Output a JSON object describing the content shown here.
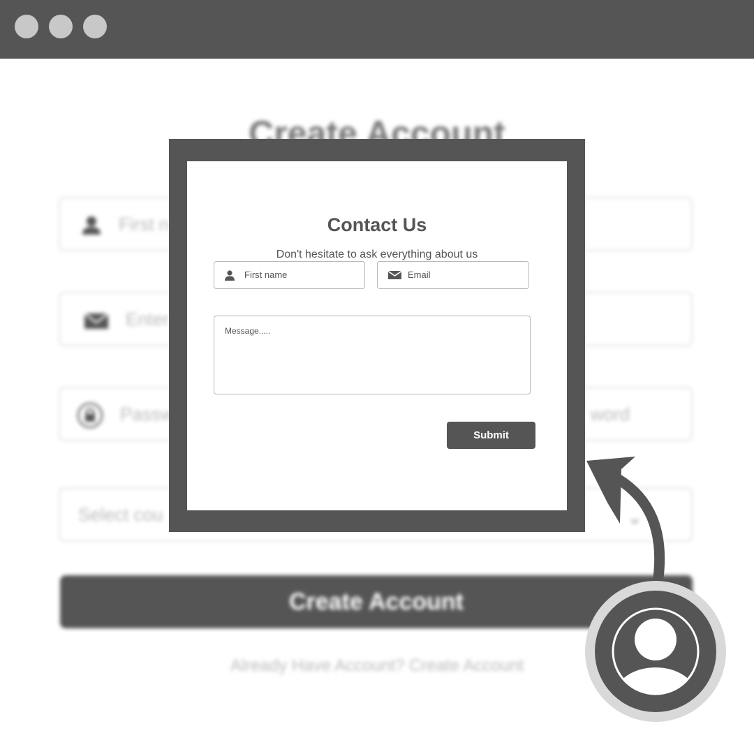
{
  "window": {
    "controls": [
      "close",
      "minimize",
      "maximize"
    ]
  },
  "background_form": {
    "title": "Create Account",
    "fields": [
      {
        "placeholder": "First n",
        "icon": "user-icon"
      },
      {
        "placeholder": "Enter",
        "icon": "mail-icon"
      },
      {
        "placeholder": "Passw",
        "right_text": "word",
        "icon": "lock-icon"
      },
      {
        "placeholder": "Select cou",
        "icon": "chevron-down-icon"
      }
    ],
    "button_label": "Create Account",
    "footer": "Already Have Account? Create Account"
  },
  "modal": {
    "title": "Contact Us",
    "subtitle": "Don't hesitate to ask everything about us",
    "first_name_placeholder": "First name",
    "email_placeholder": "Email",
    "message_placeholder": "Message.....",
    "submit_label": "Submit"
  },
  "colors": {
    "dark": "#555555",
    "light": "#d9d9d9",
    "dot": "#c8c8c8"
  },
  "icons": {
    "avatar": "user-circle-icon",
    "arrow": "curved-arrow-icon"
  }
}
